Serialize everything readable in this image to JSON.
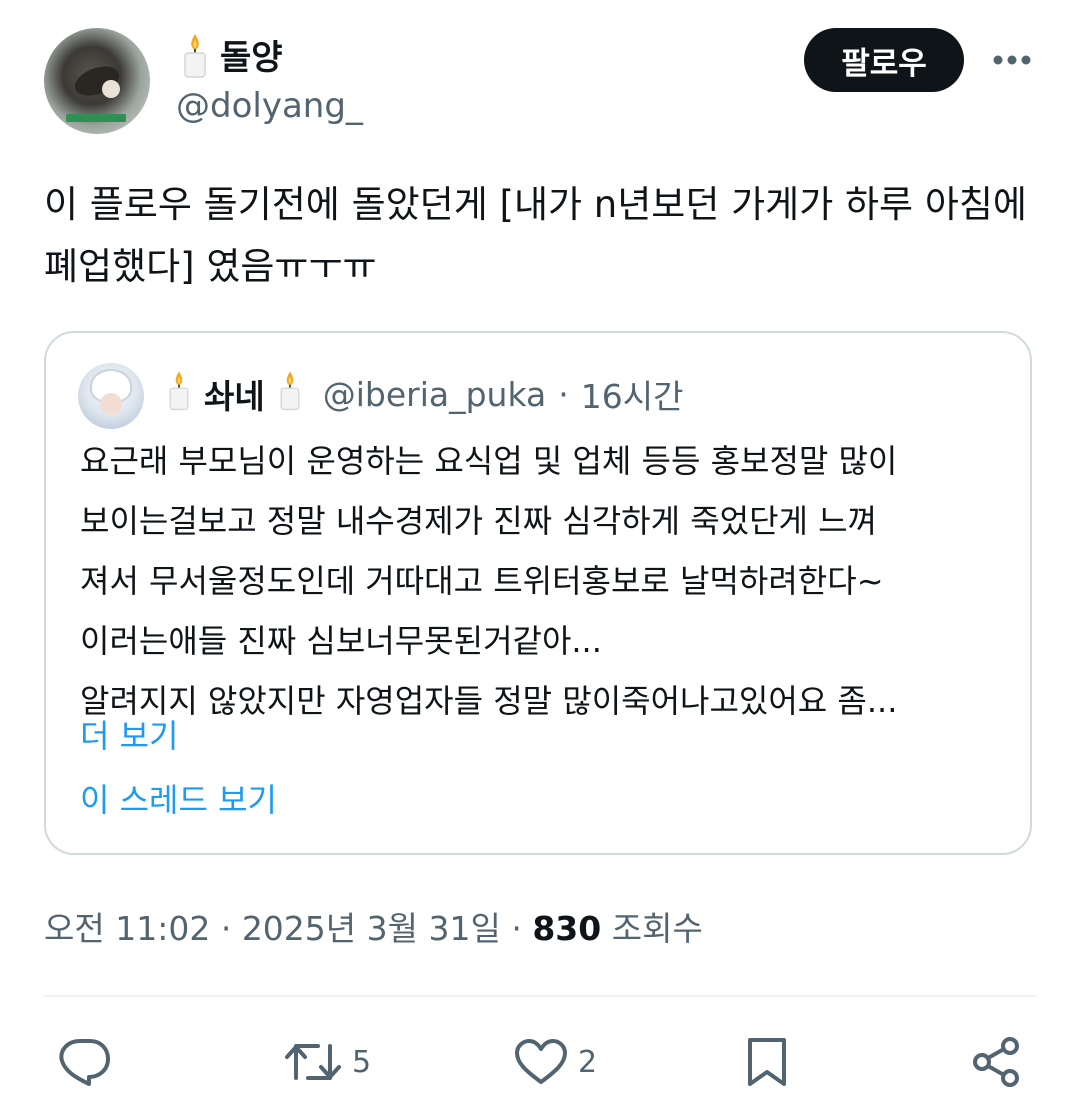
{
  "author": {
    "display_name": "돌양",
    "handle": "@dolyang_"
  },
  "buttons": {
    "follow_label": "팔로우",
    "more_icon": "more-horizontal-icon"
  },
  "tweet": {
    "text": "이 플로우 돌기전에 돌았던게 [내가 n년보던 가게가 하루 아침에 폐업했다] 였음ㅠㅜㅠ"
  },
  "quoted": {
    "display_name": "솨네",
    "handle": "@iberia_puka",
    "separator": "·",
    "time_ago": "16시간",
    "lines": [
      "요근래 부모님이 운영하는 요식업 및 업체 등등 홍보정말 많이",
      "보이는걸보고 정말 내수경제가 진짜 심각하게 죽었단게 느껴",
      "져서 무서울정도인데 거따대고 트위터홍보로 날먹하려한다~",
      "이러는애들 진짜 심보너무못된거같아...",
      "알려지지 않았지만 자영업자들 정말 많이죽어나고있어요 좀..."
    ],
    "show_more": "더 보기",
    "show_thread": "이 스레드 보기"
  },
  "meta": {
    "time": "오전 11:02",
    "sep1": "·",
    "date": "2025년 3월 31일",
    "sep2": "·",
    "views_count": "830",
    "views_label": "조회수"
  },
  "actions": {
    "reply_count": "",
    "retweet_count": "5",
    "like_count": "2"
  },
  "colors": {
    "link": "#1d9bf0",
    "secondary_text": "#536471",
    "primary_text": "#0f1419",
    "border": "#cfd9de"
  }
}
